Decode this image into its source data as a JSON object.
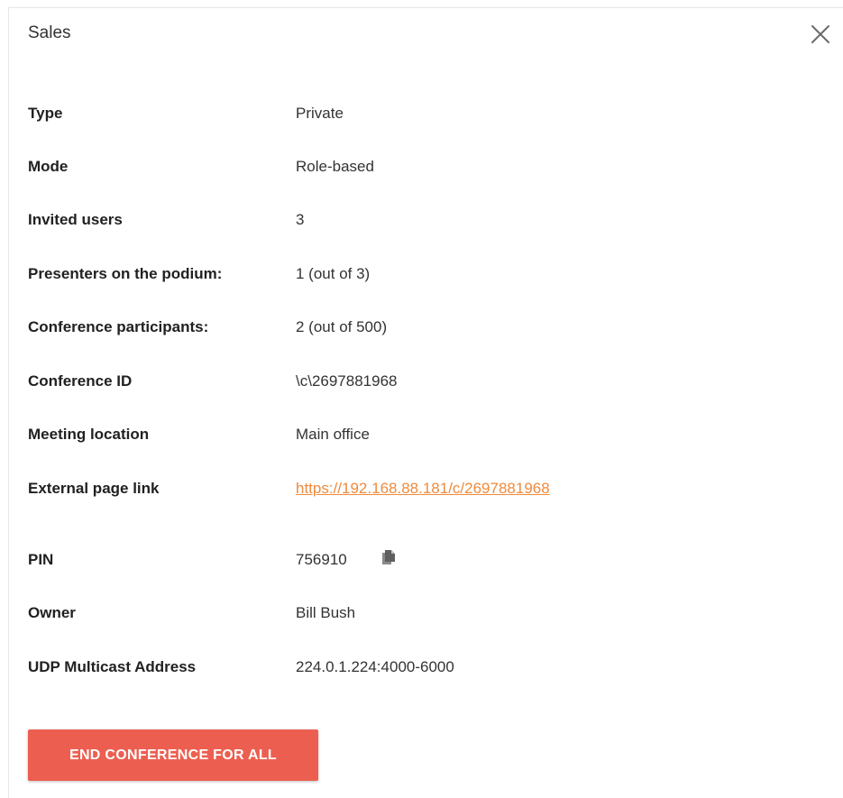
{
  "dialog": {
    "title": "Sales",
    "close_label": "close"
  },
  "details": [
    {
      "label": "Type",
      "value": "Private"
    },
    {
      "label": "Mode",
      "value": "Role-based"
    },
    {
      "label": "Invited users",
      "value": "3"
    },
    {
      "label": "Presenters on the podium:",
      "value": "1 (out of 3)"
    },
    {
      "label": "Conference participants:",
      "value": "2 (out of 500)"
    },
    {
      "label": "Conference ID",
      "value": "\\c\\2697881968"
    },
    {
      "label": "Meeting location",
      "value": "Main office"
    },
    {
      "label": "External page link",
      "value": "https://192.168.88.181/c/2697881968"
    },
    {
      "label": "PIN",
      "value": "756910"
    },
    {
      "label": "Owner",
      "value": "Bill Bush"
    },
    {
      "label": "UDP Multicast Address",
      "value": "224.0.1.224:4000-6000"
    }
  ],
  "icons": {
    "close": "close-icon",
    "copy": "copy-icon"
  },
  "actions": {
    "end_conference_label": "END CONFERENCE FOR ALL"
  },
  "colors": {
    "link": "#f08a3c",
    "end_button": "#ec5f50",
    "icon_gray": "#6b6b6b"
  }
}
